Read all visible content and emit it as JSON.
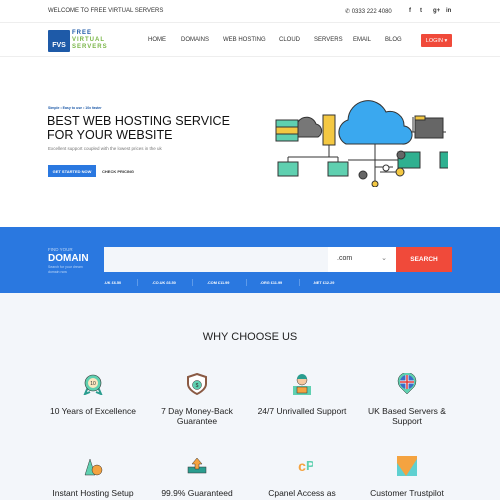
{
  "topbar": {
    "welcome": "WELCOME TO FREE VIRTUAL SERVERS",
    "phone": "0333 222 4080",
    "social": [
      "f",
      "t",
      "g+",
      "in"
    ]
  },
  "nav": {
    "logo_mark": "FVS",
    "logo_lines": [
      "FREE",
      "VIRTUAL",
      "SERVERS"
    ],
    "items": [
      "HOME",
      "DOMAINS",
      "WEB HOSTING",
      "CLOUD",
      "SERVERS",
      "EMAIL",
      "BLOG"
    ],
    "login": "LOGIN ▾"
  },
  "hero": {
    "crumbs": "Simple  •  Easy to use  •  10x faster",
    "title": "BEST WEB HOSTING SERVICE FOR YOUR WEBSITE",
    "subtitle": "Excellent support coupled with the lowest prices in the uk",
    "cta": "GET STARTED NOW",
    "secondary": "CHECK PRICING"
  },
  "domain": {
    "find": "FIND YOUR",
    "title": "DOMAIN",
    "sub": "Search for your dream domain now",
    "input_value": "",
    "selected_tld": ".com",
    "search": "SEARCH",
    "prices": [
      ".UK £6.50",
      ".CO.UK £6.50",
      ".COM £11.99",
      ".ORG £11.99",
      ".NET £12.29"
    ]
  },
  "why": {
    "title": "WHY CHOOSE US",
    "features": [
      {
        "label": "10 Years of Excellence",
        "icon": "award-badge-icon"
      },
      {
        "label": "7 Day Money-Back Guarantee",
        "icon": "money-shield-icon"
      },
      {
        "label": "24/7 Unrivalled Support",
        "icon": "support-agent-icon"
      },
      {
        "label": "UK Based Servers & Support",
        "icon": "uk-flag-pin-icon"
      },
      {
        "label": "Instant Hosting Setup",
        "icon": "rocket-icon"
      },
      {
        "label": "99.9% Guaranteed",
        "icon": "uptime-upload-icon"
      },
      {
        "label": "Cpanel Access as",
        "icon": "cpanel-icon"
      },
      {
        "label": "Customer Trustpilot",
        "icon": "trustpilot-icon"
      }
    ]
  },
  "colors": {
    "brand": "#1e5aa8",
    "accent": "#2a78e0",
    "login": "#f04a3a",
    "green": "#7ab648"
  }
}
